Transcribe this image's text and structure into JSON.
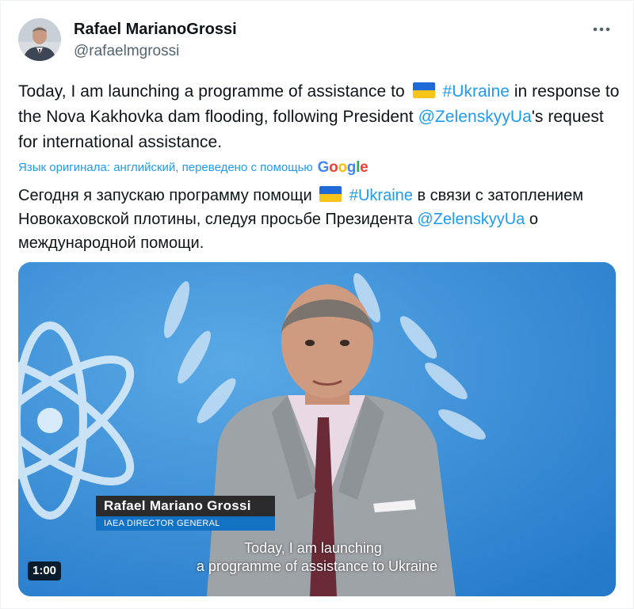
{
  "author": {
    "display_name": "Rafael MarianoGrossi",
    "handle": "@rafaelmgrossi"
  },
  "more_icon": "more-horizontal-icon",
  "tweet": {
    "seg1": "Today, I am launching a programme of assistance to ",
    "hashtag": "#Ukraine",
    "seg2": " in response to the Nova Kakhovka dam flooding, following President ",
    "mention": "@ZelenskyyUa",
    "seg3": "'s request for international assistance."
  },
  "translation": {
    "label": "Язык оригинала: английский, переведено с помощью",
    "provider": "Google",
    "seg1": "Сегодня я запускаю программу помощи ",
    "hashtag": "#Ukraine",
    "seg2": " в связи с затоплением Новокаховской плотины, следуя просьбе Президента ",
    "mention": "@ZelenskyyUa",
    "seg3": " о международной помощи."
  },
  "video": {
    "lower_third_name": "Rafael Mariano Grossi",
    "lower_third_title": "IAEA DIRECTOR GENERAL",
    "subtitle_line1": "Today, I am launching",
    "subtitle_line2": "a programme of assistance to Ukraine",
    "duration": "1:00"
  },
  "colors": {
    "link": "#1d9bf0",
    "video_background": "#2f8ed8",
    "flag_blue": "#1f6ad8",
    "flag_yellow": "#f7c51a"
  }
}
